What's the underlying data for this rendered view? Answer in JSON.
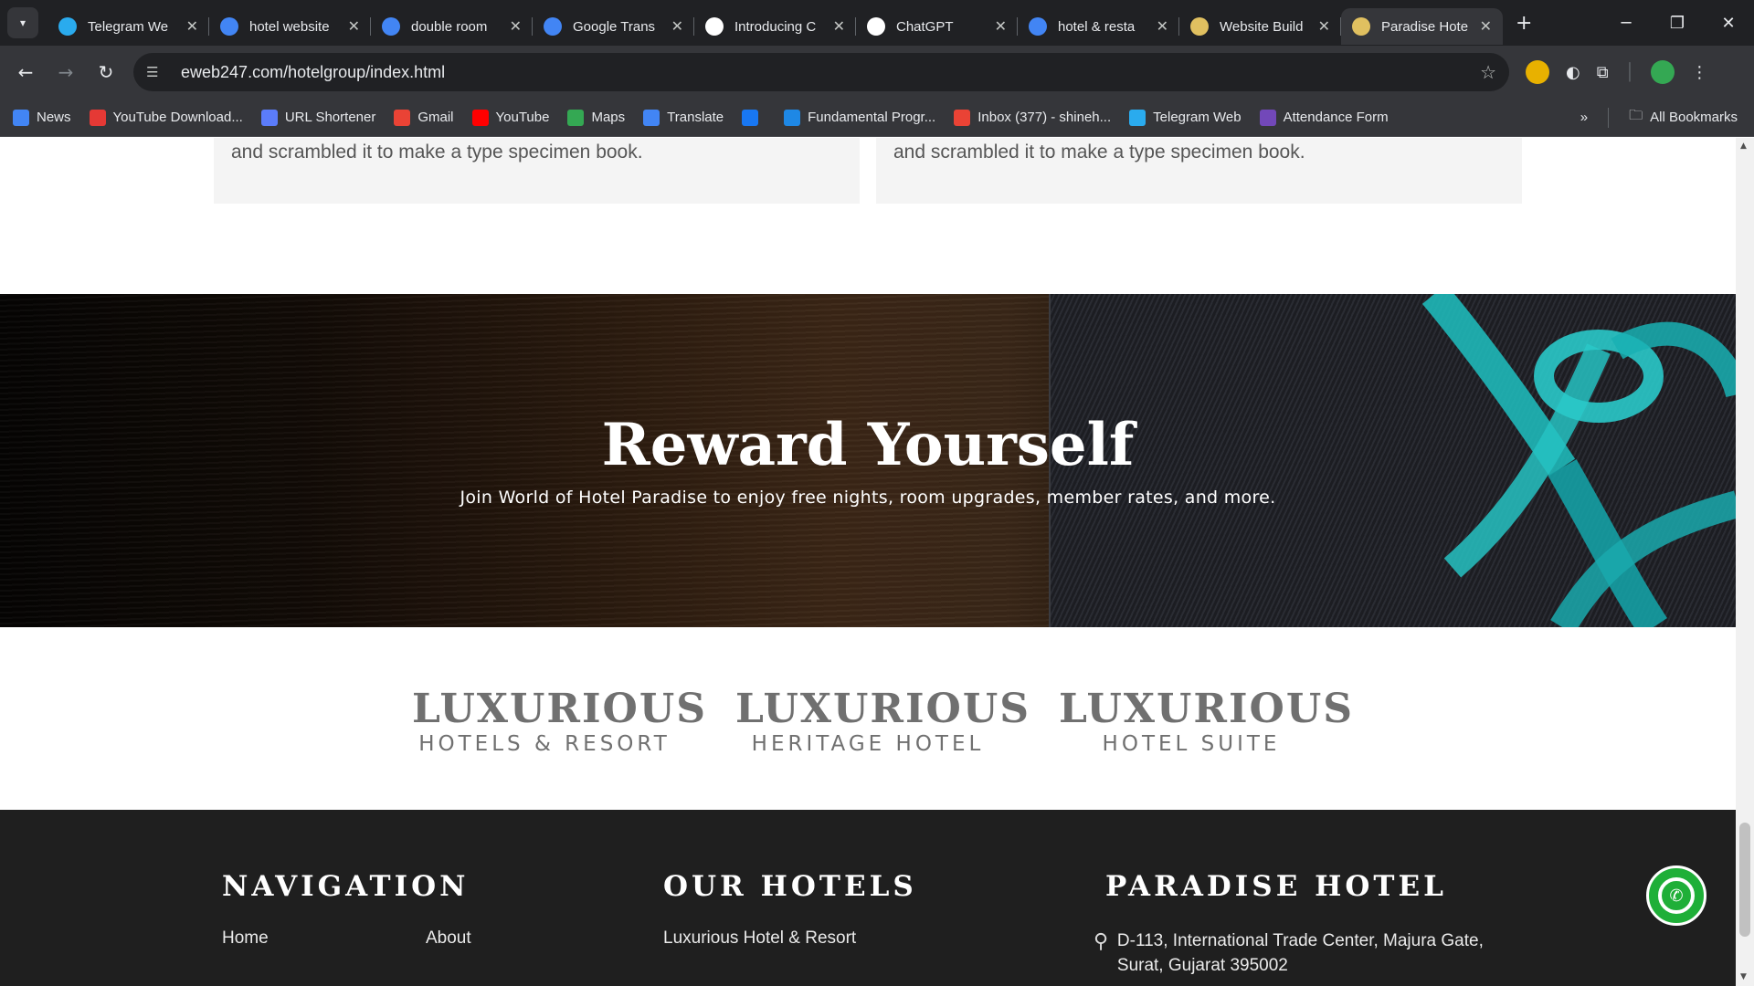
{
  "browser": {
    "tabs": [
      {
        "title": "Telegram We",
        "icon": "telegram-icon",
        "color": "#2aabee"
      },
      {
        "title": "hotel website",
        "icon": "google-icon",
        "color": "#4285f4"
      },
      {
        "title": "double room",
        "icon": "google-icon",
        "color": "#4285f4"
      },
      {
        "title": "Google Trans",
        "icon": "google-translate-icon",
        "color": "#4285f4"
      },
      {
        "title": "Introducing C",
        "icon": "openai-icon",
        "color": "#ffffff"
      },
      {
        "title": "ChatGPT",
        "icon": "openai-icon",
        "color": "#ffffff"
      },
      {
        "title": "hotel & resta",
        "icon": "google-icon",
        "color": "#4285f4"
      },
      {
        "title": "Website Build",
        "icon": "moon-icon",
        "color": "#e0c060"
      },
      {
        "title": "Paradise Hote",
        "icon": "moon-icon",
        "color": "#e0c060",
        "active": true
      }
    ],
    "url": "eweb247.com/hotelgroup/index.html",
    "bookmarks": [
      {
        "label": "News",
        "icon": "news-icon",
        "color": "#4285f4"
      },
      {
        "label": "YouTube Download...",
        "icon": "download-icon",
        "color": "#e53935"
      },
      {
        "label": "URL Shortener",
        "icon": "link-icon",
        "color": "#5b7cfa"
      },
      {
        "label": "Gmail",
        "icon": "gmail-icon",
        "color": "#ea4335"
      },
      {
        "label": "YouTube",
        "icon": "youtube-icon",
        "color": "#ff0000"
      },
      {
        "label": "Maps",
        "icon": "maps-icon",
        "color": "#34a853"
      },
      {
        "label": "Translate",
        "icon": "google-translate-icon",
        "color": "#4285f4"
      },
      {
        "label": "",
        "icon": "facebook-icon",
        "color": "#1877f2"
      },
      {
        "label": "Fundamental Progr...",
        "icon": "classroom-icon",
        "color": "#1e88e5"
      },
      {
        "label": "Inbox (377) - shineh...",
        "icon": "gmail-icon",
        "color": "#ea4335"
      },
      {
        "label": "Telegram Web",
        "icon": "telegram-icon",
        "color": "#2aabee"
      },
      {
        "label": "Attendance Form",
        "icon": "forms-icon",
        "color": "#7248b9"
      }
    ],
    "all_bookmarks": "All Bookmarks"
  },
  "page": {
    "card_left_text": "and scrambled it to make a type specimen book.",
    "card_right_text": "and scrambled it to make a type specimen book.",
    "reward_title": "Reward Yourself",
    "reward_subtitle": "Join World of Hotel Paradise to enjoy free nights, room upgrades, member rates, and more.",
    "brands": [
      {
        "big": "LUXURIOUS",
        "small": "HOTELS & RESORT"
      },
      {
        "big": "LUXURIOUS",
        "small": "HERITAGE HOTEL"
      },
      {
        "big": "LUXURIOUS",
        "small": "HOTEL SUITE"
      }
    ],
    "footer": {
      "navigation_heading": "NAVIGATION",
      "hotels_heading": "OUR HOTELS",
      "paradise_heading": "PARADISE HOTEL",
      "nav_home": "Home",
      "nav_about": "About",
      "hotel_link_1": "Luxurious Hotel & Resort",
      "address": "D-113, International Trade Center, Majura Gate, Surat, Gujarat 395002"
    }
  },
  "colors": {
    "accent_teal": "#1fb8b8",
    "footer_bg": "#1f1f1f",
    "whatsapp": "#1faf38"
  }
}
